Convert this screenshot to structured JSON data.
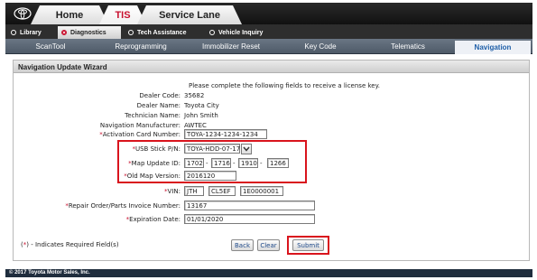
{
  "top_tabs": {
    "home": "Home",
    "tis": "TIS",
    "service_lane": "Service Lane"
  },
  "nav_tabs": [
    {
      "label": "Library"
    },
    {
      "label": "Diagnostics"
    },
    {
      "label": "Tech Assistance"
    },
    {
      "label": "Vehicle Inquiry"
    }
  ],
  "sub_tabs": [
    "ScanTool",
    "Reprogramming",
    "Immobilizer Reset",
    "Key Code",
    "Telematics",
    "Navigation"
  ],
  "panel": {
    "title": "Navigation Update Wizard"
  },
  "form": {
    "intro": "Please complete the following fields to receive a license key.",
    "dealer_code_label": "Dealer Code:",
    "dealer_code": "35682",
    "dealer_name_label": "Dealer Name:",
    "dealer_name": "Toyota City",
    "technician_label": "Technician Name:",
    "technician": "John Smith",
    "manufacturer_label": "Navigation Manufacturer:",
    "manufacturer": "AWTEC",
    "activation_label": "Activation Card Number:",
    "activation": "TOYA-1234-1234-1234",
    "usb_label": "USB Stick P/N:",
    "usb_value": "TOYA-HDD-07-17",
    "map_update_label": "Map Update ID:",
    "map_update": [
      "1702",
      "1716",
      "1910",
      "1266"
    ],
    "old_map_label": "Old Map Version:",
    "old_map": "2016120",
    "vin_label": "VIN:",
    "vin": [
      "JTH",
      "CL5EF",
      "1E0000001"
    ],
    "repair_label": "Repair Order/Parts Invoice Number:",
    "repair": "13167",
    "expiration_label": "Expiration Date:",
    "expiration": "01/01/2020",
    "required_note": "- Indicates Required Field(s)",
    "asterisk": "*",
    "required_open": "(",
    "required_close": ")",
    "dash": "-"
  },
  "buttons": {
    "back": "Back",
    "clear": "Clear",
    "submit": "Submit"
  },
  "footer": "© 2017 Toyota Motor Sales, Inc.",
  "colors": {
    "accent_red": "#d9141d",
    "active_tab_text": "#1f5fa8"
  }
}
